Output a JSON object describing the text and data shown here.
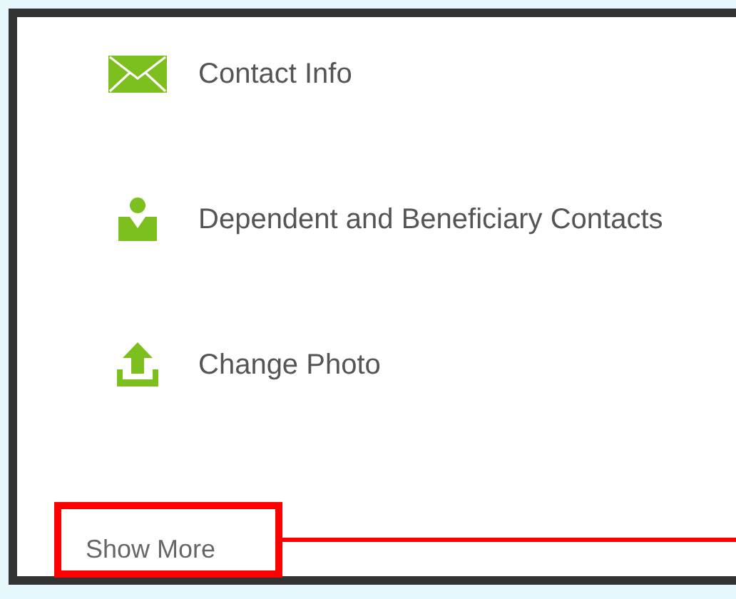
{
  "items": [
    {
      "label": "Contact Info",
      "kind": "envelope"
    },
    {
      "label": "Dependent and Beneficiary Contacts",
      "kind": "person"
    },
    {
      "label": "Change Photo",
      "kind": "upload"
    }
  ],
  "show_more": {
    "label": "Show More"
  }
}
